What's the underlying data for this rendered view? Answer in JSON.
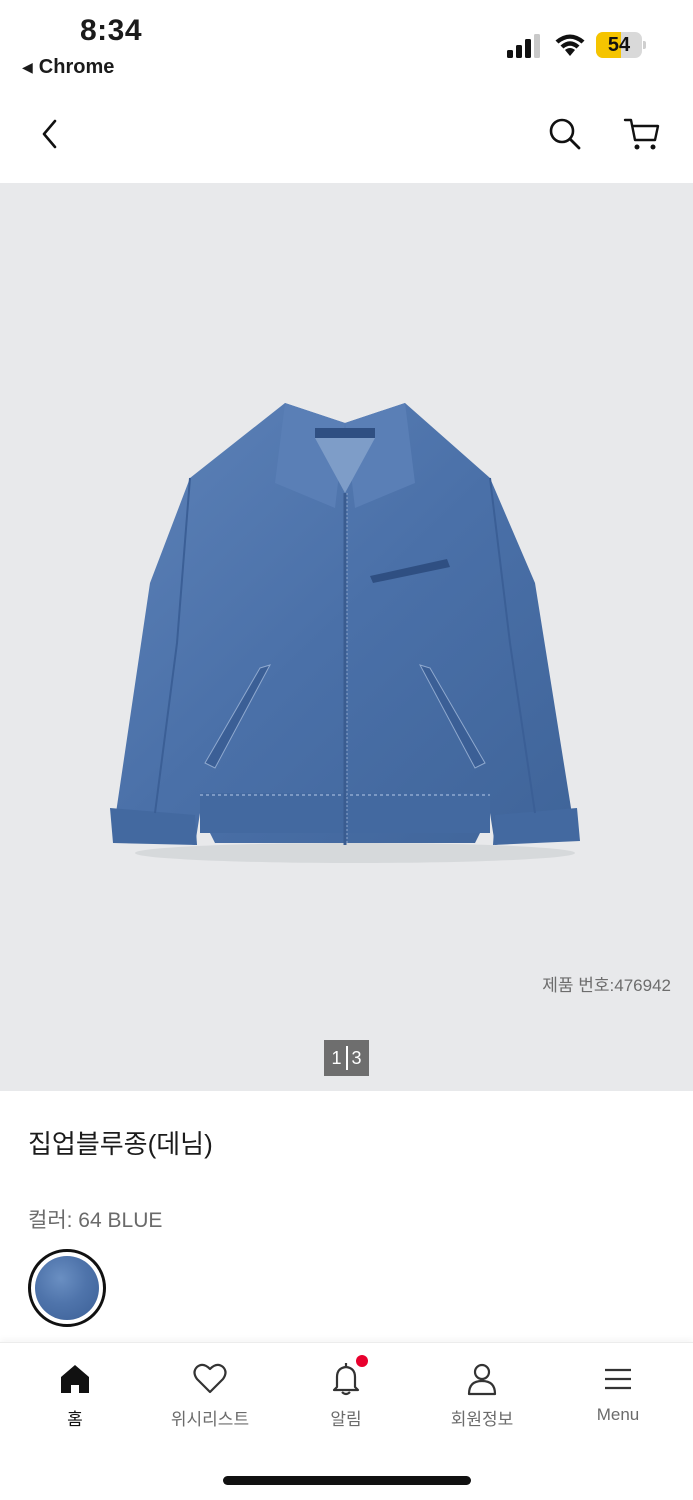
{
  "status_bar": {
    "time": "8:34",
    "back_app": "Chrome",
    "battery_level": "54",
    "battery_fraction": 0.54
  },
  "header": {
    "back_icon": "chevron-left-icon",
    "search_icon": "search-icon",
    "cart_icon": "cart-icon"
  },
  "gallery": {
    "product_number": "제품 번호:476942",
    "page_current": "1",
    "page_total": "3",
    "image": "denim-jacket"
  },
  "product": {
    "name": "집업블루종(데님)",
    "color_label": "컬러: 64 BLUE",
    "swatch_color": "#4f74ab"
  },
  "tabbar": {
    "items": [
      {
        "label": "홈",
        "icon": "home-icon",
        "active": true
      },
      {
        "label": "위시리스트",
        "icon": "heart-icon",
        "active": false
      },
      {
        "label": "알림",
        "icon": "bell-icon",
        "active": false,
        "badge": true
      },
      {
        "label": "회원정보",
        "icon": "user-icon",
        "active": false
      },
      {
        "label": "Menu",
        "icon": "menu-icon",
        "active": false
      }
    ],
    "badge_color": "#e8002d"
  }
}
